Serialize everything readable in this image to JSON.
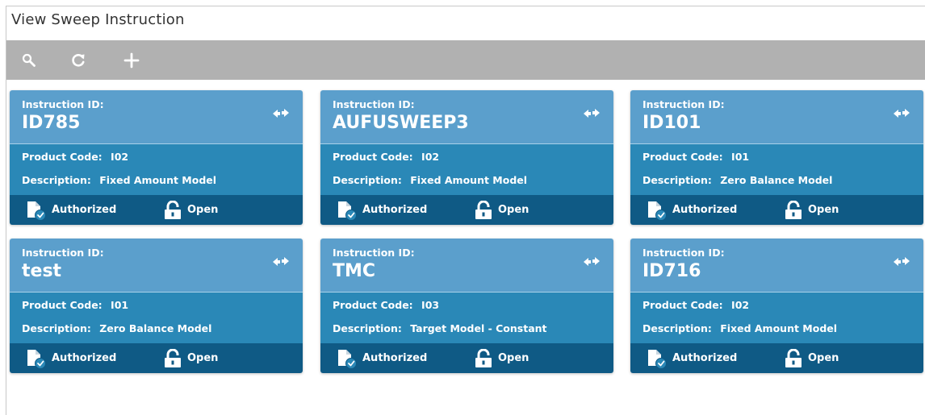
{
  "page": {
    "title": "View Sweep Instruction"
  },
  "toolbar": {
    "buttons": [
      {
        "name": "search-button",
        "icon": "search-icon"
      },
      {
        "name": "refresh-button",
        "icon": "refresh-icon"
      },
      {
        "name": "add-button",
        "icon": "plus-icon"
      }
    ]
  },
  "labels": {
    "instruction_id": "Instruction ID:",
    "product_code": "Product Code:",
    "description": "Description:",
    "authorized": "Authorized",
    "open": "Open"
  },
  "colors": {
    "toolbar": "#b1b1b1",
    "card_header": "#5b9fcc",
    "card_body": "#2a88b7",
    "card_footer": "#0f5a85"
  },
  "cards": [
    {
      "instruction_id": "ID785",
      "product_code": "I02",
      "description": "Fixed Amount Model",
      "auth_status": "Authorized",
      "record_status": "Open"
    },
    {
      "instruction_id": "AUFUSWEEP3",
      "product_code": "I02",
      "description": "Fixed Amount Model",
      "auth_status": "Authorized",
      "record_status": "Open"
    },
    {
      "instruction_id": "ID101",
      "product_code": "I01",
      "description": "Zero Balance Model",
      "auth_status": "Authorized",
      "record_status": "Open"
    },
    {
      "instruction_id": "test",
      "product_code": "I01",
      "description": "Zero Balance Model",
      "auth_status": "Authorized",
      "record_status": "Open"
    },
    {
      "instruction_id": "TMC",
      "product_code": "I03",
      "description": "Target Model - Constant",
      "auth_status": "Authorized",
      "record_status": "Open"
    },
    {
      "instruction_id": "ID716",
      "product_code": "I02",
      "description": "Fixed Amount Model",
      "auth_status": "Authorized",
      "record_status": "Open"
    }
  ]
}
